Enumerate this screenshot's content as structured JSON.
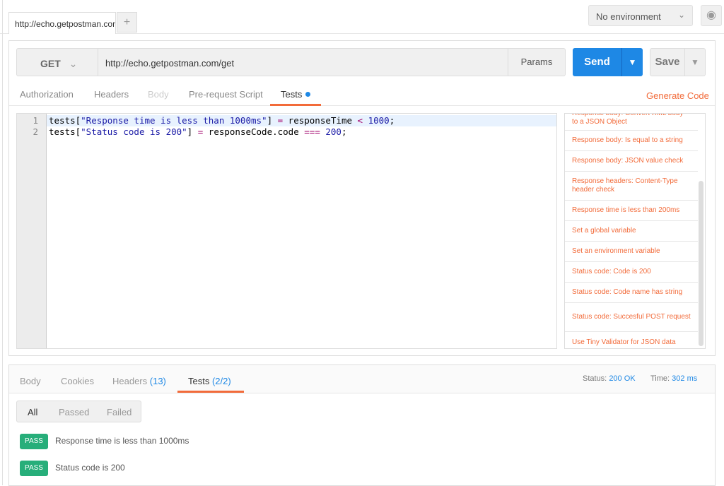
{
  "tabs": {
    "active_tab": "http://echo.getpostman.com",
    "add_label": "+"
  },
  "environment": {
    "selected": "No environment"
  },
  "request": {
    "method": "GET",
    "url": "http://echo.getpostman.com/get",
    "params_label": "Params",
    "send_label": "Send",
    "save_label": "Save"
  },
  "request_tabs": [
    "Authorization",
    "Headers",
    "Body",
    "Pre-request Script",
    "Tests"
  ],
  "generate_code": "Generate Code",
  "editor": {
    "lines": [
      {
        "n": "1",
        "t1": "tests[",
        "s": "\"Response time is less than 1000ms\"",
        "t2": "] ",
        "o1": "=",
        "t3": " responseTime ",
        "o2": "<",
        "t4": " ",
        "num": "1000",
        "t5": ";"
      },
      {
        "n": "2",
        "t1": "tests[",
        "s": "\"Status code is 200\"",
        "t2": "] ",
        "o1": "=",
        "t3": " responseCode.code ",
        "o2": "===",
        "t4": " ",
        "num": "200",
        "t5": ";"
      }
    ]
  },
  "snippets": [
    "Response body: Convert XML body to a JSON Object",
    "Response body: Is equal to a string",
    "Response body: JSON value check",
    "Response headers: Content-Type header check",
    "Response time is less than 200ms",
    "Set a global variable",
    "Set an environment variable",
    "Status code: Code is 200",
    "Status code: Code name has string",
    "Status code: Succesful POST request",
    "Use Tiny Validator for JSON data"
  ],
  "response": {
    "tabs": {
      "body": "Body",
      "cookies": "Cookies",
      "headers": "Headers",
      "headers_count": "(13)",
      "tests": "Tests",
      "tests_count": "(2/2)"
    },
    "status_label": "Status:",
    "status": "200 OK",
    "time_label": "Time:",
    "time": "302 ms",
    "filters": [
      "All",
      "Passed",
      "Failed"
    ],
    "results": [
      {
        "badge": "PASS",
        "name": "Response time is less than 1000ms"
      },
      {
        "badge": "PASS",
        "name": "Status code is 200"
      }
    ]
  },
  "colors": {
    "accent": "#f26b3a",
    "send": "#1e88e5",
    "pass": "#27ae7a"
  }
}
